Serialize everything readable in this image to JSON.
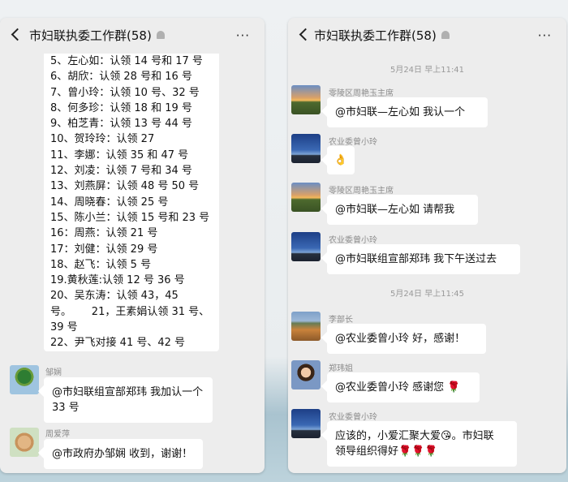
{
  "left": {
    "header": {
      "title": "市妇联执委工作群(58)",
      "more": "···"
    },
    "claims": [
      "5、左心如：认领 14 号和 17 号",
      "6、胡欣：认领 28 号和 16 号",
      "7、曾小玲：认领 10 号、32 号",
      "8、何多珍：认领 18 和 19 号",
      "9、柏芝青：认领 13 号 44 号",
      "10、贺玲玲：认领 27",
      "11、李娜：认领 35 和 47 号",
      "12、刘凌：认领 7 号和 34 号",
      "13、刘燕屏：认领 48 号 50 号",
      "14、周晓春：认领 25 号",
      "15、陈小兰：认领 15 号和 23 号",
      "16：周燕：认领 21 号",
      "17：刘健：认领 29 号",
      "18、赵飞：认领 5 号",
      "19.黄秋莲:认领 12 号 36 号",
      "20、吴东涛：认领 43，45",
      "号。      21，王素娟认领 31 号、",
      "39 号",
      "22、尹飞对接 41 号、42 号"
    ],
    "messages": [
      {
        "sender": "邹娴",
        "lines": [
          "@市妇联组宣部郑玮  我加认一个",
          "33 号"
        ]
      },
      {
        "sender": "周爱萍",
        "lines": [
          "@市政府办邹娴  收到，谢谢！"
        ]
      }
    ]
  },
  "right": {
    "header": {
      "title": "市妇联执委工作群(58)",
      "more": "···"
    },
    "time1": "5月24日 早上11:41",
    "time2": "5月24日 早上11:45",
    "messages": [
      {
        "sender": "零陵区周艳玉主席",
        "text": "@市妇联—左心如  我认一个"
      },
      {
        "sender": "农业委曾小玲",
        "text": "👌"
      },
      {
        "sender": "零陵区周艳玉主席",
        "text": "@市妇联—左心如  请帮我"
      },
      {
        "sender": "农业委曾小玲",
        "text": "@市妇联组宣部郑玮  我下午送过去"
      },
      {
        "sender": "李部长",
        "text": "@农业委曾小玲  好，感谢！"
      },
      {
        "sender": "郑玮姐",
        "text": "@农业委曾小玲  感谢您",
        "emoji": "🌹"
      },
      {
        "sender": "农业委曾小玲",
        "line1": "应该的，小爱汇聚大爱",
        "emoji_wink": "😘",
        "line1b": "。市妇联",
        "line2": "领导组织得好",
        "emoji_roses": "🌹🌹🌹"
      }
    ]
  }
}
